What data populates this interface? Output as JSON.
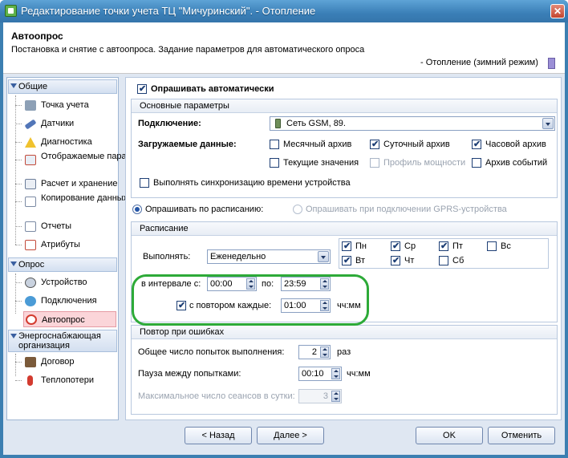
{
  "window": {
    "title": "Редактирование точки учета ТЦ \"Мичуринский\". - Отопление",
    "close": "✕"
  },
  "header": {
    "title": "Автоопрос",
    "subtitle": "Постановка и снятие с автоопроса. Задание параметров для автоматического опроса",
    "mode": "- Отопление (зимний режим)"
  },
  "nav": {
    "groups": [
      "Общие",
      "Опрос",
      "Энергоснабжающая организация"
    ],
    "general": [
      "Точка учета",
      "Датчики",
      "Диагностика",
      "Отображаемые параметры",
      "Расчет и хранение",
      "Копирование данных",
      "Отчеты",
      "Атрибуты"
    ],
    "poll": [
      "Устройство",
      "Подключения",
      "Автоопрос"
    ],
    "supplier": [
      "Договор",
      "Теплопотери"
    ]
  },
  "auto": {
    "label": "Опрашивать автоматически",
    "checked": true
  },
  "basic": {
    "title": "Основные параметры",
    "conn_label": "Подключение:",
    "conn_value": "Сеть GSM, 89.",
    "data_label": "Загружаемые данные:",
    "items": [
      {
        "label": "Месячный архив",
        "checked": false
      },
      {
        "label": "Суточный архив",
        "checked": true
      },
      {
        "label": "Часовой архив",
        "checked": true
      },
      {
        "label": "Текущие значения",
        "checked": false
      },
      {
        "label": "Профиль мощности",
        "checked": false
      },
      {
        "label": "Архив событий",
        "checked": false
      }
    ],
    "sync_label": "Выполнять синхронизацию времени устройства"
  },
  "radio": {
    "schedule": "Опрашивать по расписанию:",
    "gprs": "Опрашивать при подключении GPRS-устройства"
  },
  "schedule": {
    "title": "Расписание",
    "exec_label": "Выполнять:",
    "exec_value": "Еженедельно",
    "days": [
      {
        "label": "Пн",
        "checked": true
      },
      {
        "label": "Ср",
        "checked": true
      },
      {
        "label": "Пт",
        "checked": true
      },
      {
        "label": "Вс",
        "checked": false
      },
      {
        "label": "Вт",
        "checked": true
      },
      {
        "label": "Чт",
        "checked": true
      },
      {
        "label": "Сб",
        "checked": false
      }
    ],
    "interval_label": "в интервале с:",
    "from": "00:00",
    "to_label": "по:",
    "to": "23:59",
    "repeat_label": "с повтором каждые:",
    "repeat": "01:00",
    "unit": "чч:мм"
  },
  "errors": {
    "title": "Повтор при ошибках",
    "attempts_label": "Общее число попыток выполнения:",
    "attempts": "2",
    "attempts_unit": "раз",
    "pause_label": "Пауза между попытками:",
    "pause": "00:10",
    "pause_unit": "чч:мм",
    "sessions_label": "Максимальное число сеансов в сутки:",
    "sessions": "3"
  },
  "buttons": {
    "back": "< Назад",
    "next": "Далее >",
    "ok": "OK",
    "cancel": "Отменить"
  },
  "colors": {
    "titlebar": "#3a7fb7",
    "panel": "#dfe7f2",
    "selected": "#fbd5d9",
    "highlight": "#2daa38"
  }
}
